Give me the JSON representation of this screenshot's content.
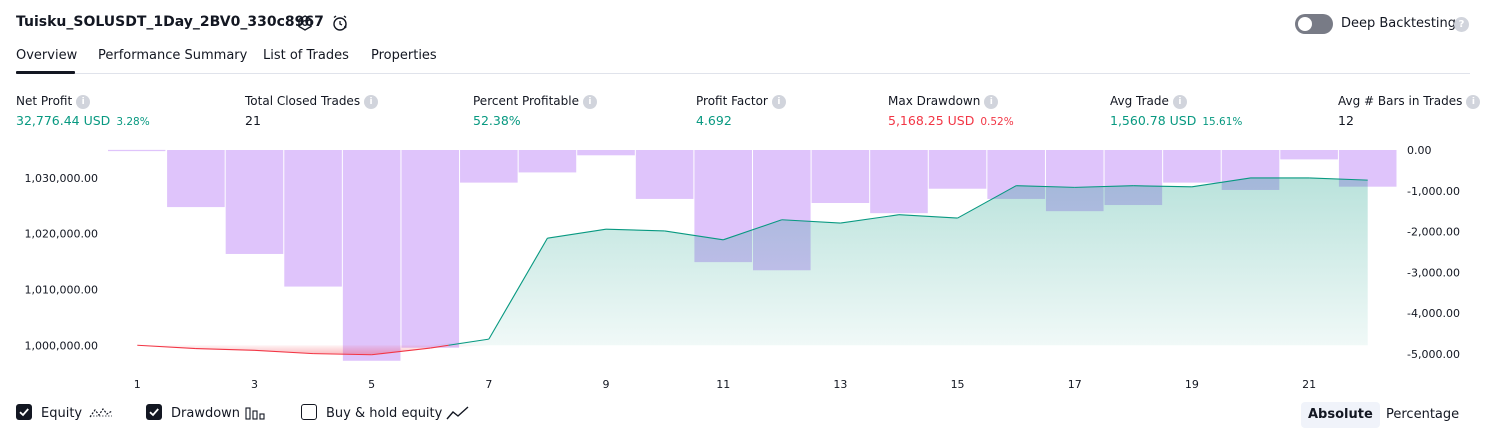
{
  "header": {
    "title": "Tuisku_SOLUSDT_1Day_2BV0_330c8967",
    "deep_backtesting_label": "Deep Backtesting",
    "deep_backtesting_enabled": false
  },
  "tabs": [
    {
      "label": "Overview",
      "active": true
    },
    {
      "label": "Performance Summary",
      "active": false
    },
    {
      "label": "List of Trades",
      "active": false
    },
    {
      "label": "Properties",
      "active": false
    }
  ],
  "metrics": {
    "net_profit": {
      "label": "Net Profit",
      "value": "32,776.44 USD",
      "pct": "3.28%"
    },
    "total_closed_trades": {
      "label": "Total Closed Trades",
      "value": "21"
    },
    "percent_profitable": {
      "label": "Percent Profitable",
      "value": "52.38%"
    },
    "profit_factor": {
      "label": "Profit Factor",
      "value": "4.692"
    },
    "max_drawdown": {
      "label": "Max Drawdown",
      "value": "5,168.25 USD",
      "pct": "0.52%"
    },
    "avg_trade": {
      "label": "Avg Trade",
      "value": "1,560.78 USD",
      "pct": "15.61%"
    },
    "avg_bars": {
      "label": "Avg # Bars in Trades",
      "value": "12"
    }
  },
  "legend": {
    "equity": {
      "label": "Equity",
      "checked": true
    },
    "drawdown": {
      "label": "Drawdown",
      "checked": true
    },
    "buy_hold": {
      "label": "Buy & hold equity",
      "checked": false
    }
  },
  "mode_buttons": {
    "absolute": "Absolute",
    "percentage": "Percentage",
    "selected": "Absolute"
  },
  "colors": {
    "equity_line": "#089981",
    "equity_fill": "#c8ebe2",
    "equity_loss_line": "#f23645",
    "drawdown_bar": "#dfc4fb",
    "positive": "#089981",
    "negative": "#f23645"
  },
  "chart_data": {
    "type": "area",
    "x_tick_labels": [
      "1",
      "3",
      "5",
      "7",
      "9",
      "11",
      "13",
      "15",
      "17",
      "19",
      "21"
    ],
    "x": [
      1,
      2,
      3,
      4,
      5,
      6,
      7,
      8,
      9,
      10,
      11,
      12,
      13,
      14,
      15,
      16,
      17,
      18,
      19,
      20,
      21,
      22
    ],
    "left_axis": {
      "ticks": [
        "1,030,000.00",
        "1,020,000.00",
        "1,010,000.00",
        "1,000,000.00"
      ],
      "range": [
        997000,
        1035000
      ]
    },
    "right_axis": {
      "ticks": [
        "0.00",
        "-1,000.00",
        "-2,000.00",
        "-3,000.00",
        "-4,000.00",
        "-5,000.00"
      ],
      "range": [
        -5200,
        0
      ]
    },
    "baseline": 1000000,
    "series": [
      {
        "key": "equity",
        "values": [
          1000000,
          999400,
          999100,
          998500,
          998300,
          999500,
          1001100,
          1019200,
          1020800,
          1020500,
          1018900,
          1022500,
          1021900,
          1023400,
          1022800,
          1028600,
          1028300,
          1028600,
          1028400,
          1030000,
          1030000,
          1029600
        ]
      },
      {
        "key": "drawdown",
        "values": [
          0,
          -1400,
          -2550,
          -3350,
          -5170,
          -4850,
          -800,
          -550,
          -130,
          -1200,
          -2750,
          -2950,
          -1300,
          -1550,
          -950,
          -1200,
          -1500,
          -1350,
          -800,
          -980,
          -230,
          -900
        ]
      }
    ]
  }
}
